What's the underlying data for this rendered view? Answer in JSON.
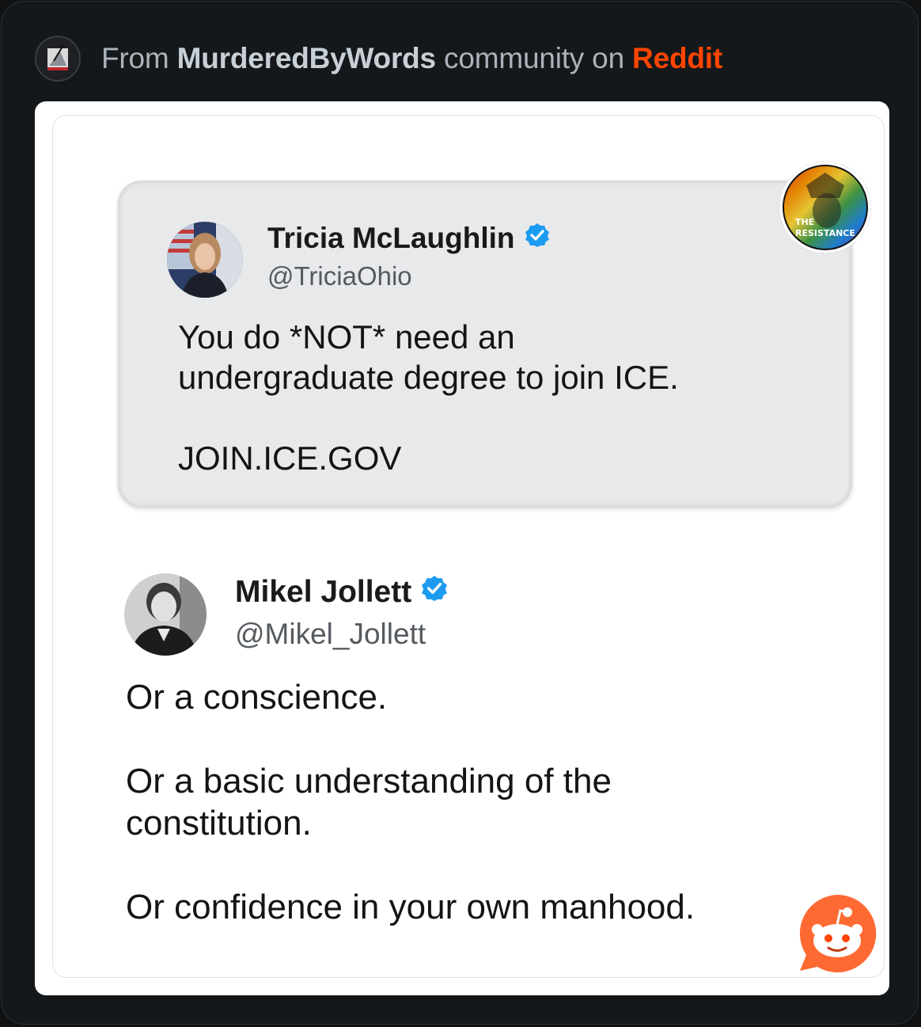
{
  "header": {
    "prefix": "From",
    "community": "MurderedByWords",
    "middle": "community on",
    "platform": "Reddit"
  },
  "post_image": {
    "resistance_badge": {
      "line1": "THE",
      "line2": "RESISTANCE"
    },
    "quoted_tweet": {
      "author_name": "Tricia McLaughlin",
      "handle": "@TriciaOhio",
      "verified": true,
      "text": "You do *NOT* need an\nundergraduate degree to join ICE.\n\nJOIN.ICE.GOV"
    },
    "reply_tweet": {
      "author_name": "Mikel Jollett",
      "handle": "@Mikel_Jollett",
      "verified": true,
      "text": "Or a conscience.\n\nOr a basic understanding of the\nconstitution.\n\nOr confidence in your own manhood."
    }
  },
  "colors": {
    "reddit_orange": "#ff4500",
    "verified_blue": "#1d9bf0",
    "snoo_orange": "#ff6a33"
  },
  "icons": [
    "community-avatar-icon",
    "verified-badge-icon",
    "resistance-logo-icon",
    "reddit-snoo-icon"
  ]
}
